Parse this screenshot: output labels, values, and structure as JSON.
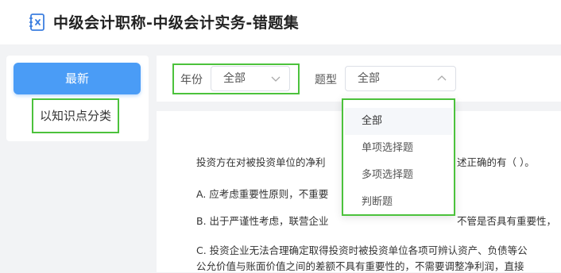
{
  "header": {
    "title": "中级会计职称-中级会计实务-错题集",
    "logo_icon": "notebook-icon"
  },
  "sidebar": {
    "latest_label": "最新",
    "knowledge_label": "以知识点分类"
  },
  "filters": {
    "year_label": "年份",
    "year_value": "全部",
    "type_label": "题型",
    "type_value": "全部"
  },
  "dropdown": {
    "options": [
      "全部",
      "单项选择题",
      "多项选择题",
      "判断题"
    ]
  },
  "question": {
    "stem_a": "投资方在对被投资单位的净利",
    "stem_b": "述正确的有（    ）。",
    "option_a": "A. 应考虑重要性原则，不重要",
    "option_b": "B. 出于严谨性考虑，联营企业",
    "option_b_tail": "不管是否具有重要性，",
    "option_c_line1": "C. 投资企业无法合理确定取得投资时被投资单位各项可辨认资产、负债等公",
    "option_c_line2": "公允价值与账面价值之间的差额不具有重要性的，不需要调整净利润，直接"
  },
  "colors": {
    "accent": "#4a9cf6",
    "highlight": "#4cc23c",
    "background": "#f2f3f5"
  }
}
